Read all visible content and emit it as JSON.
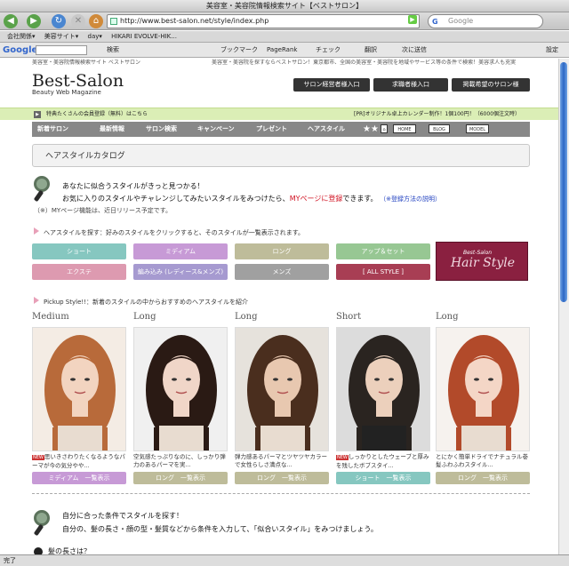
{
  "window": {
    "title": "美容室・美容院情報検索サイト【ベストサロン】"
  },
  "toolbar": {
    "url": "http://www.best-salon.net/style/index.php",
    "search_placeholder": "Google",
    "search_engine_icon": "G"
  },
  "bookmarks": [
    "会社関係▾",
    "美容サイト▾",
    "day▾",
    "HIKARI EVOLVE-HIK..."
  ],
  "gbar": {
    "logo": "Google",
    "search_label": "検索",
    "bookmark_label": "ブックマーク",
    "pagerank_label": "PageRank",
    "check_label": "チェック",
    "translate_label": "翻訳",
    "send_label": "次に送信",
    "settings_label": "設定"
  },
  "site": {
    "top_left_note": "美容室・美容院情報検索サイト ベストサロン",
    "top_right_note": "美容室・美容院を探すならベストサロン！東京都市、全国の美容室・美容院を地域やサービス等の条件で検索！美容求人も充実",
    "logo_title": "Best-Salon",
    "logo_subtitle": "Beauty Web Magazine",
    "header_buttons": [
      "サロン経営者様入口",
      "求職者様入口",
      "掲載希望のサロン様"
    ],
    "announcement": "特典たくさんの会員登録（無料）はこちら",
    "calendar": "[PR]オリジナル卓上カレンダー制作！1個100円！（6000個注文時）",
    "nav": [
      "新着サロン",
      "最新情報",
      "サロン検索",
      "キャンペーン",
      "プレゼント",
      "ヘアスタイル"
    ],
    "nav_icons": [
      "HOME",
      "BLOG",
      "MODEL"
    ]
  },
  "section": {
    "heading": "ヘアスタイルカタログ",
    "intro_line1": "あなたに似合うスタイルがきっと見つかる！",
    "intro_line2_pre": "お気に入りのスタイルやチャレンジしてみたいスタイルをみつけたら、",
    "intro_line2_link": "MYページに登録",
    "intro_line2_post": "できます。",
    "intro_help": "（※登録方法の説明）",
    "intro_note": "（※）MYページ機能は、近日リリース予定です。"
  },
  "search": {
    "label": "ヘアスタイルを探す：好みのスタイルをクリックすると、そのスタイルが一覧表示されます。",
    "buttons": [
      {
        "label": "ショート",
        "color": "#86c7c0"
      },
      {
        "label": "ミディアム",
        "color": "#c79ad6"
      },
      {
        "label": "ロング",
        "color": "#bebc9a"
      },
      {
        "label": "アップ＆セット",
        "color": "#97c793"
      },
      {
        "label": "エクステ",
        "color": "#dd9ab0"
      },
      {
        "label": "編み込み (レディース&メンズ)",
        "color": "#a69ad0"
      },
      {
        "label": "メンズ",
        "color": "#a0a0a0"
      },
      {
        "label": "[ ALL STYLE ]",
        "color": "#a83e54"
      }
    ],
    "banner_top": "Best-Salon",
    "banner_main": "Hair Style"
  },
  "pickup": {
    "label": "Pickup Style!!：新着のスタイルの中からおすすめのヘアスタイルを紹介",
    "items": [
      {
        "tag": "Medium",
        "new_badge": "NEW",
        "desc": "思いきさわりたくなるようなパーマが今の気分やや...",
        "button": "ミディアム　一覧表示",
        "color": "#c79ad6",
        "hair": "#b86a3a",
        "skin": "#f2d4c0",
        "bg": "#f4ece4"
      },
      {
        "tag": "Long",
        "new_badge": "",
        "desc": "空気感たっぷりなのに、しっかり弾力のあるパーマを実...",
        "button": "ロング　一覧表示",
        "color": "#bebc9a",
        "hair": "#2a1a14",
        "skin": "#f0d6c8",
        "bg": "#f0f0f0"
      },
      {
        "tag": "Long",
        "new_badge": "",
        "desc": "弾力感あるパーマとツヤツヤカラーで女性らしさ満点な...",
        "button": "ロング　一覧表示",
        "color": "#bebc9a",
        "hair": "#4a2e1e",
        "skin": "#e8c8b0",
        "bg": "#e6e2dc"
      },
      {
        "tag": "Short",
        "new_badge": "NEW",
        "desc": "しっかりとしたウェーブと厚みを残したボブスタイ...",
        "button": "ショート　一覧表示",
        "color": "#86c7c0",
        "hair": "#2a2420",
        "skin": "#ecd0bc",
        "bg": "#dcdcdc"
      },
      {
        "tag": "Long",
        "new_badge": "",
        "desc": "とにかく簡単ドライでナチュラル巻髪ふわふわスタイル...",
        "button": "ロング　一覧表示",
        "color": "#bebc9a",
        "hair": "#b24a2a",
        "skin": "#f4d6c6",
        "bg": "#f6f2ee"
      }
    ]
  },
  "condition": {
    "line1": "自分に合った条件でスタイルを探す！",
    "line2": "自分の、髪の長さ・顔の型・髪質などから条件を入力して、「似合いスタイル」をみつけましょう。",
    "step1": "髪の長さは？"
  },
  "status": {
    "text": "完了"
  }
}
